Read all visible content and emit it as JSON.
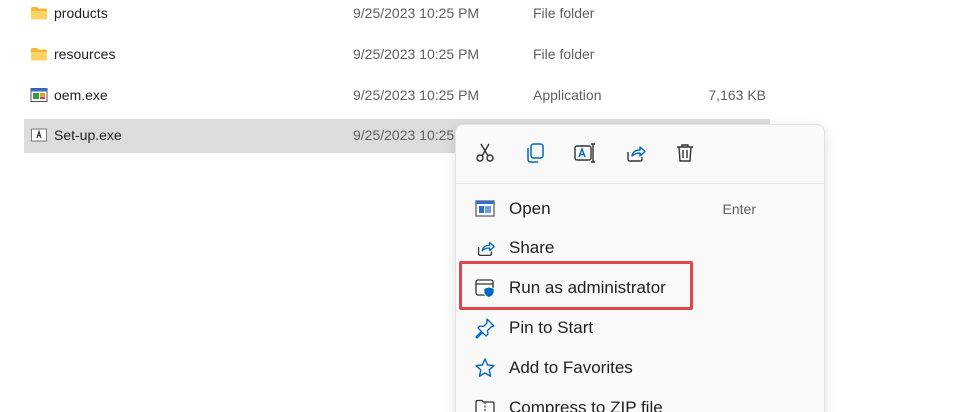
{
  "files": [
    {
      "name": "products",
      "date": "9/25/2023 10:25 PM",
      "type": "File folder",
      "size": "",
      "icon": "folder-icon"
    },
    {
      "name": "resources",
      "date": "9/25/2023 10:25 PM",
      "type": "File folder",
      "size": "",
      "icon": "folder-icon"
    },
    {
      "name": "oem.exe",
      "date": "9/25/2023 10:25 PM",
      "type": "Application",
      "size": "7,163 KB",
      "icon": "application-icon"
    },
    {
      "name": "Set-up.exe",
      "date": "9/25/2023 10:25",
      "type": "",
      "size": "",
      "icon": "adobe-app-icon"
    }
  ],
  "context_menu": {
    "actions": [
      {
        "icon": "cut-icon"
      },
      {
        "icon": "copy-icon"
      },
      {
        "icon": "rename-icon"
      },
      {
        "icon": "share-icon"
      },
      {
        "icon": "delete-icon"
      }
    ],
    "items": [
      {
        "label": "Open",
        "shortcut": "Enter",
        "icon": "open-window-icon"
      },
      {
        "label": "Share",
        "shortcut": "",
        "icon": "share-icon"
      },
      {
        "label": "Run as administrator",
        "shortcut": "",
        "icon": "shield-window-icon"
      },
      {
        "label": "Pin to Start",
        "shortcut": "",
        "icon": "pin-icon"
      },
      {
        "label": "Add to Favorites",
        "shortcut": "",
        "icon": "star-icon"
      },
      {
        "label": "Compress to ZIP file",
        "shortcut": "",
        "icon": "zip-folder-icon"
      }
    ]
  },
  "colors": {
    "accent": "#0067c0",
    "folder": "#f8c84a",
    "selection": "#dcdcdc",
    "highlight_border": "#e0474c"
  }
}
